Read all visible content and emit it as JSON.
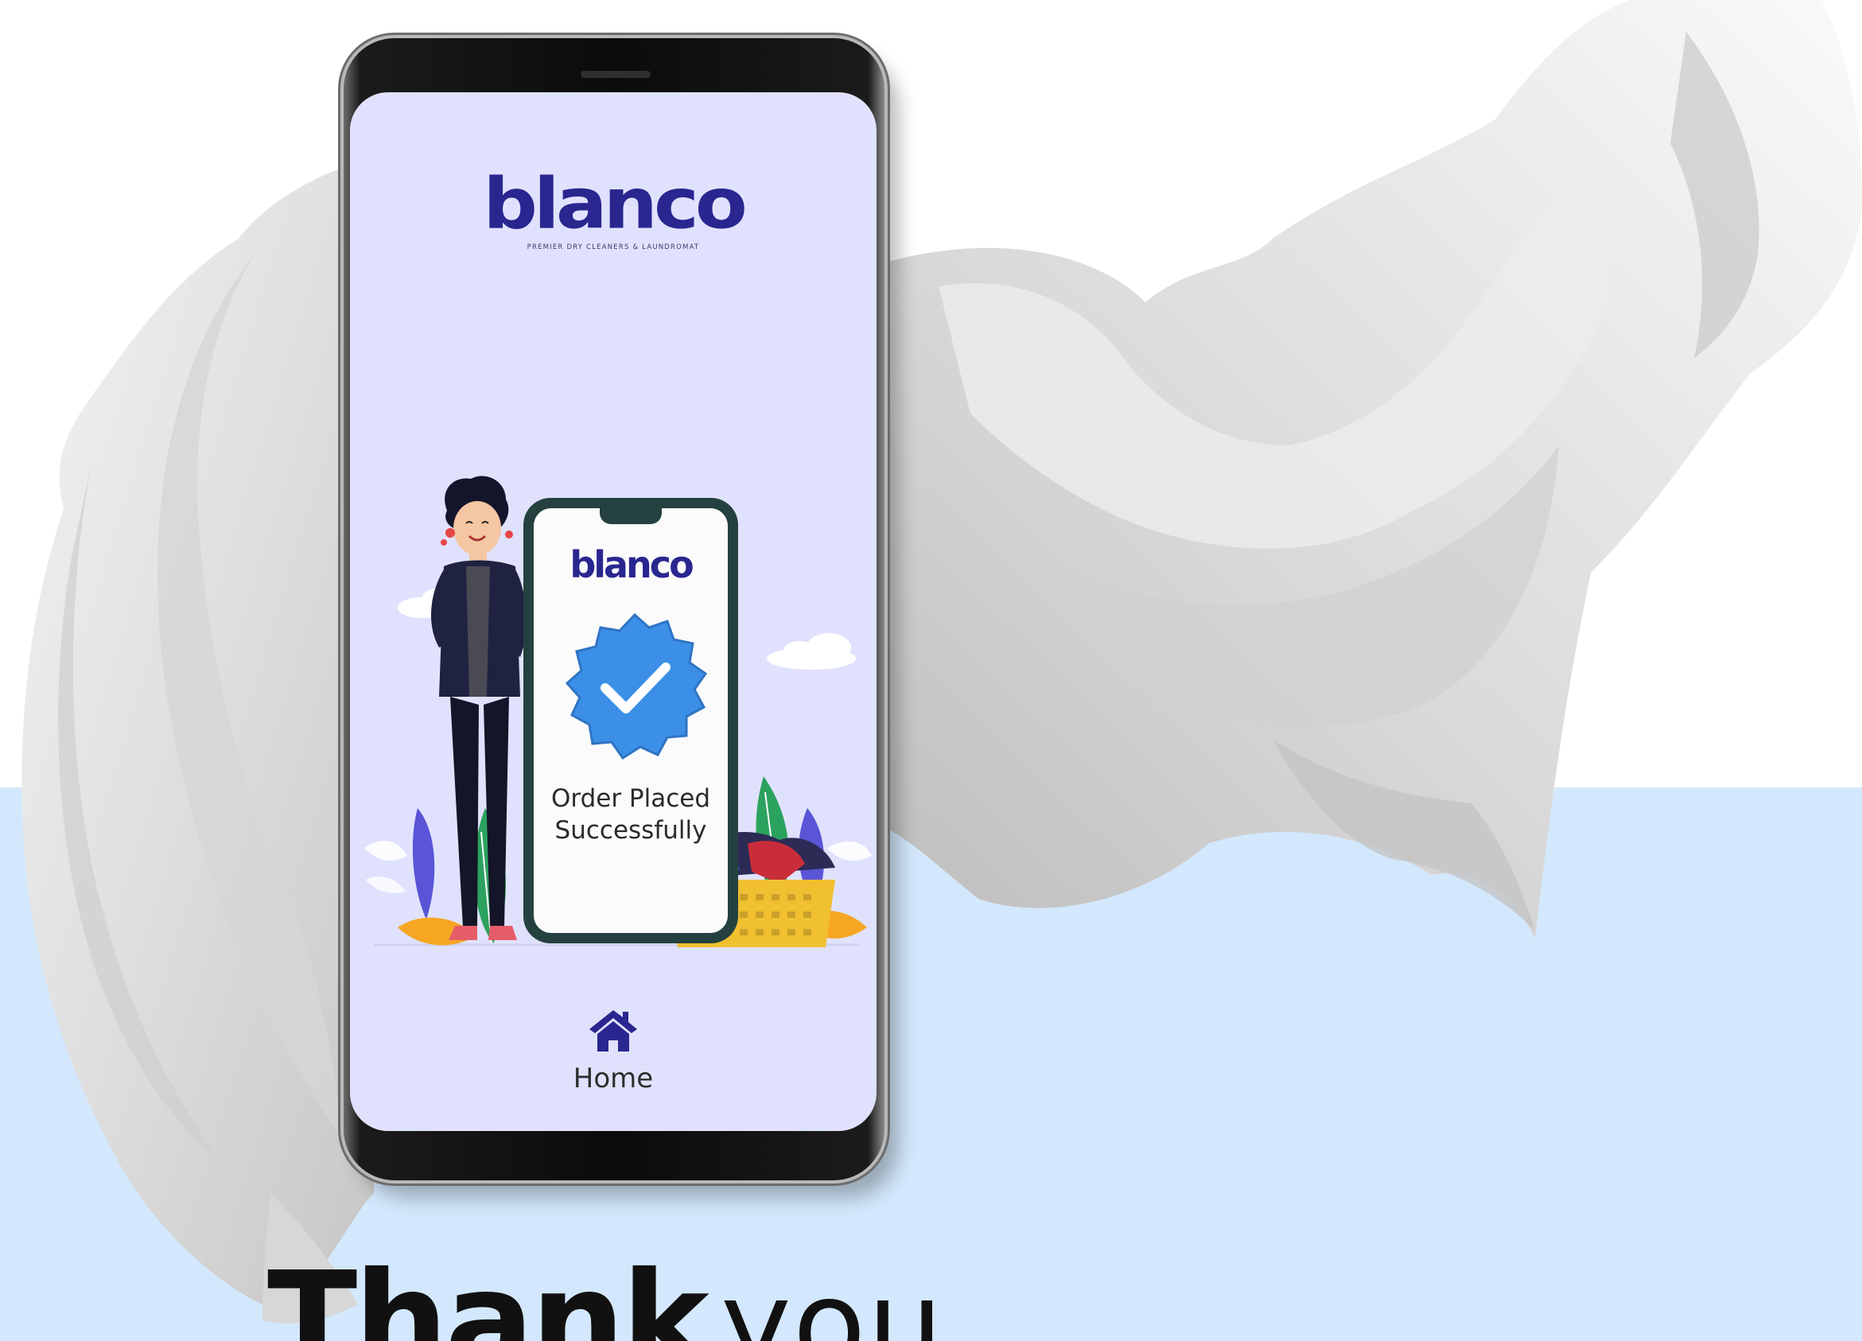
{
  "app": {
    "brand_name": "blanco",
    "brand_tagline": "PREMIER DRY CLEANERS & LAUNDROMAT"
  },
  "confirmation": {
    "illustration_logo": "blanco",
    "message_line1": "Order Placed",
    "message_line2": "Successfully"
  },
  "nav": {
    "home_label": "Home",
    "home_icon": "home-icon"
  },
  "headline": {
    "bold": "Thank",
    "light": "you"
  },
  "colors": {
    "brand": "#2a2690",
    "screen_bg": "#e0e2fd",
    "band_bg": "#d3e8fc",
    "badge": "#3b8fe6"
  }
}
